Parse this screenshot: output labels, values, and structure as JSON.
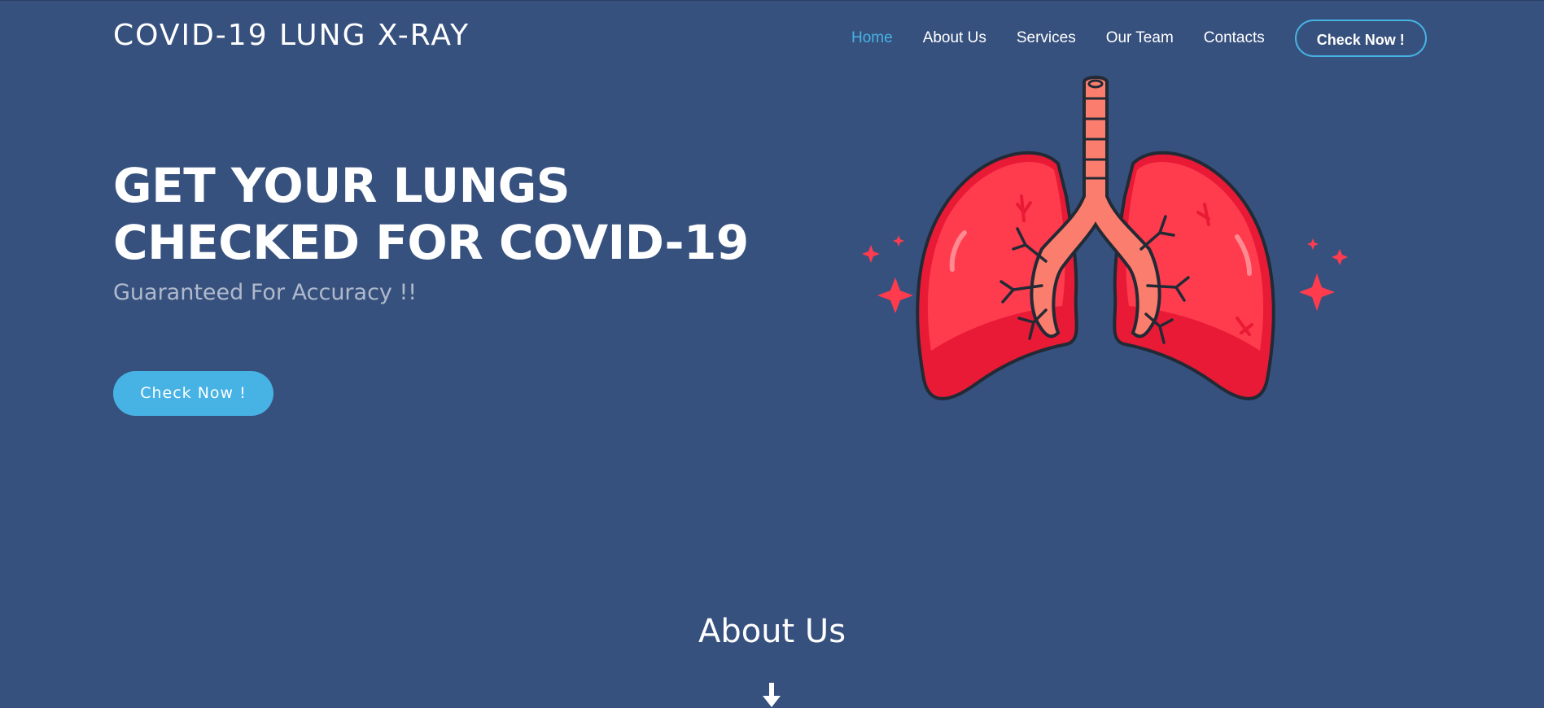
{
  "header": {
    "logo": "COVID-19 LUNG X-RAY",
    "nav": [
      {
        "label": "Home",
        "active": true
      },
      {
        "label": "About Us",
        "active": false
      },
      {
        "label": "Services",
        "active": false
      },
      {
        "label": "Our Team",
        "active": false
      },
      {
        "label": "Contacts",
        "active": false
      }
    ],
    "cta_label": "Check Now !"
  },
  "hero": {
    "title_line1": "GET YOUR LUNGS",
    "title_line2": "CHECKED FOR COVID-19",
    "subtitle": "Guaranteed For Accuracy !!",
    "button_label": "Check Now !",
    "illustration_icon": "lungs-illustration"
  },
  "about": {
    "title": "About Us",
    "scroll_icon": "arrow-down-icon"
  },
  "colors": {
    "background": "#37517e",
    "accent": "#47b2e4",
    "lung_red": "#ff3b4e",
    "lung_dark_red": "#e91a36",
    "trachea": "#fb7d6d",
    "outline": "#222a35"
  }
}
